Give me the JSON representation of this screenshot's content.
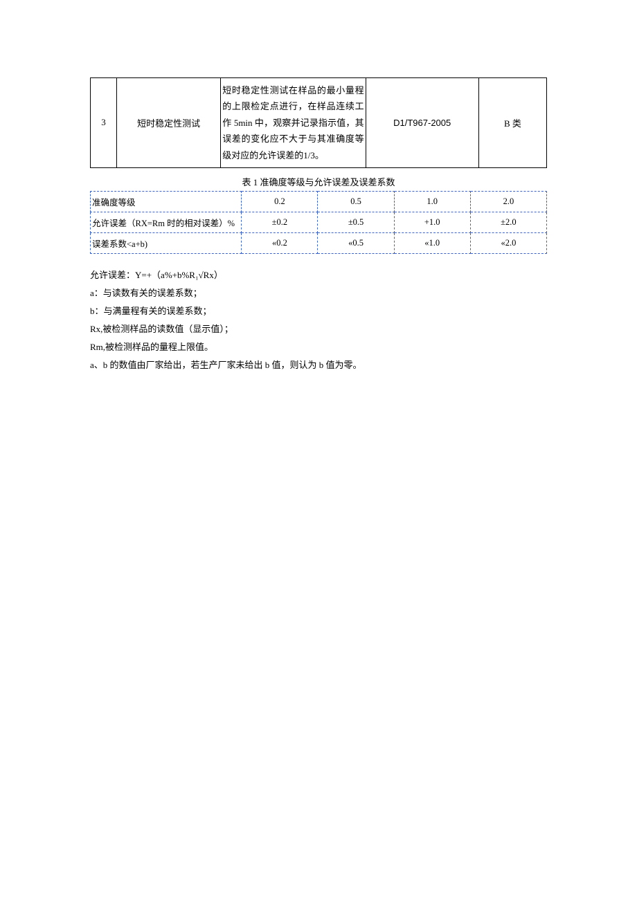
{
  "table1": {
    "row": {
      "no": "3",
      "name": "短时稳定性测试",
      "desc": "短时稳定性测试在样品的最小量程的上限检定点进行，在样品连续工作 5min 中，观察并记录指示值，其误差的变化应不大于与其准确度等级对应的允许误差的1/3。",
      "std": "D1/T967-2005",
      "cls": "B 类"
    }
  },
  "table2": {
    "caption": "表 1 准确度等级与允许误差及误差系数",
    "rows": [
      {
        "label": "准确度等级",
        "v": [
          "0.2",
          "0.5",
          "1.0",
          "2.0"
        ]
      },
      {
        "label": "允许误差（RX=Rm 时的相对误差）%",
        "v": [
          "±0.2",
          "±0.5",
          "+1.0",
          "±2.0"
        ]
      },
      {
        "label": "误差系数<a+b)",
        "v": [
          "«0.2",
          "«0.5",
          "«1.0",
          "«2.0"
        ]
      }
    ]
  },
  "notes": {
    "l1": "允许误差：Y=+（a%+b%R₁√Rx）",
    "l2": "a：与读数有关的误差系数；",
    "l3": "b：与满量程有关的误差系数；",
    "l4": "Rx,被检测样品的读数值（显示值）；",
    "l5": "Rm,被检测样品的量程上限值。",
    "l6": "a、b 的数值由厂家给出，若生产厂家未给出 b 值，则认为 b 值为零。"
  }
}
